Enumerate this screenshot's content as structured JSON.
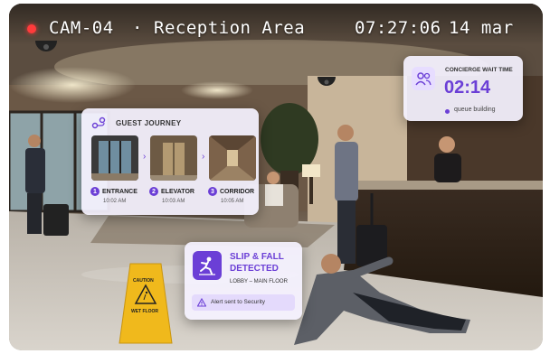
{
  "camera": {
    "id": "CAM-04",
    "separator": "·",
    "location": "Reception Area",
    "time": "07:27:06",
    "date": "14 mar"
  },
  "guest_journey": {
    "title": "GUEST JOURNEY",
    "icon": "route-icon",
    "steps": [
      {
        "num": "1",
        "label": "ENTRANCE",
        "time": "10:02 AM"
      },
      {
        "num": "2",
        "label": "ELEVATOR",
        "time": "10:03 AM"
      },
      {
        "num": "3",
        "label": "CORRIDOR",
        "time": "10:05 AM"
      }
    ]
  },
  "concierge": {
    "title": "CONCIERGE WAIT TIME",
    "value": "02:14",
    "status": "queue building",
    "status_color": "#6b3fd6",
    "icon": "users-icon"
  },
  "alert": {
    "title_line1": "SLIP & FALL",
    "title_line2": "DETECTED",
    "location": "LOBBY – MAIN FLOOR",
    "action": "Alert sent to Security",
    "icon": "person-falling-icon",
    "warning_icon": "warning-icon"
  },
  "sign": {
    "line1": "CAUTION",
    "line2": "WET FLOOR"
  },
  "colors": {
    "accent": "#6b3fd6",
    "rec": "#ff3b3b"
  }
}
